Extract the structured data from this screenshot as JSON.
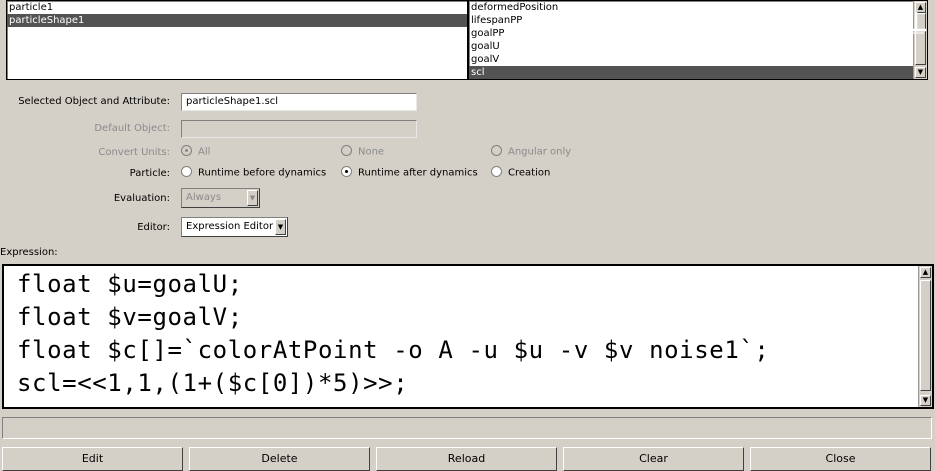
{
  "objects_list": {
    "items": [
      "particle1",
      "particleShape1"
    ],
    "selected_index": 1
  },
  "attributes_list": {
    "items": [
      "deformedPosition",
      "lifespanPP",
      "goalPP",
      "goalU",
      "goalV",
      "scl"
    ],
    "selected_index": 5
  },
  "selected_object_attr": {
    "label": "Selected Object and Attribute:",
    "value": "particleShape1.scl"
  },
  "default_object": {
    "label": "Default Object:",
    "value": ""
  },
  "convert_units": {
    "label": "Convert Units:",
    "options": [
      "All",
      "None",
      "Angular only"
    ],
    "selected": "All"
  },
  "particle": {
    "label": "Particle:",
    "options": [
      "Runtime before dynamics",
      "Runtime after dynamics",
      "Creation"
    ],
    "selected": "Runtime after dynamics"
  },
  "evaluation": {
    "label": "Evaluation:",
    "value": "Always"
  },
  "editor": {
    "label": "Editor:",
    "value": "Expression Editor"
  },
  "expression": {
    "label": "Expression:",
    "lines": [
      "float $u=goalU;",
      "float $v=goalV;",
      "float $c[]=`colorAtPoint -o A -u $u -v $v noise1`;",
      "scl=<<1,1,(1+($c[0])*5)>>;"
    ]
  },
  "buttons": {
    "edit": "Edit",
    "delete": "Delete",
    "reload": "Reload",
    "clear": "Clear",
    "close": "Close"
  },
  "colors": {
    "background": "#d4d0c8",
    "selection": "#535353"
  },
  "icons": [
    "scroll-up-arrow",
    "scroll-down-arrow",
    "combo-down-arrow",
    "watermark-logo"
  ]
}
